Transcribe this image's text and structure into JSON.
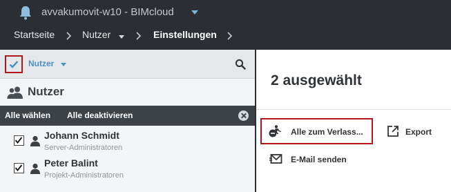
{
  "header": {
    "app_title": "avvakumovit-w10 - BIMcloud"
  },
  "breadcrumb": {
    "items": [
      "Startseite",
      "Nutzer",
      "Einstellungen"
    ]
  },
  "left_panel": {
    "filter_label": "Nutzer",
    "section_title": "Nutzer",
    "select_all": "Alle wählen",
    "deselect_all": "Alle deaktivieren",
    "users": [
      {
        "name": "Johann Schmidt",
        "role": "Server-Administratoren",
        "checked": true
      },
      {
        "name": "Peter Balint",
        "role": "Projekt-Administratoren",
        "checked": true
      }
    ]
  },
  "right_panel": {
    "count_title": "2 ausgewählt",
    "actions": {
      "leave_all": "Alle zum Verlass...",
      "export": "Export",
      "email": "E-Mail senden"
    }
  },
  "colors": {
    "header_bg": "#2b2e33",
    "accent_blue": "#4a90c2",
    "highlight_red": "#b0161c"
  }
}
